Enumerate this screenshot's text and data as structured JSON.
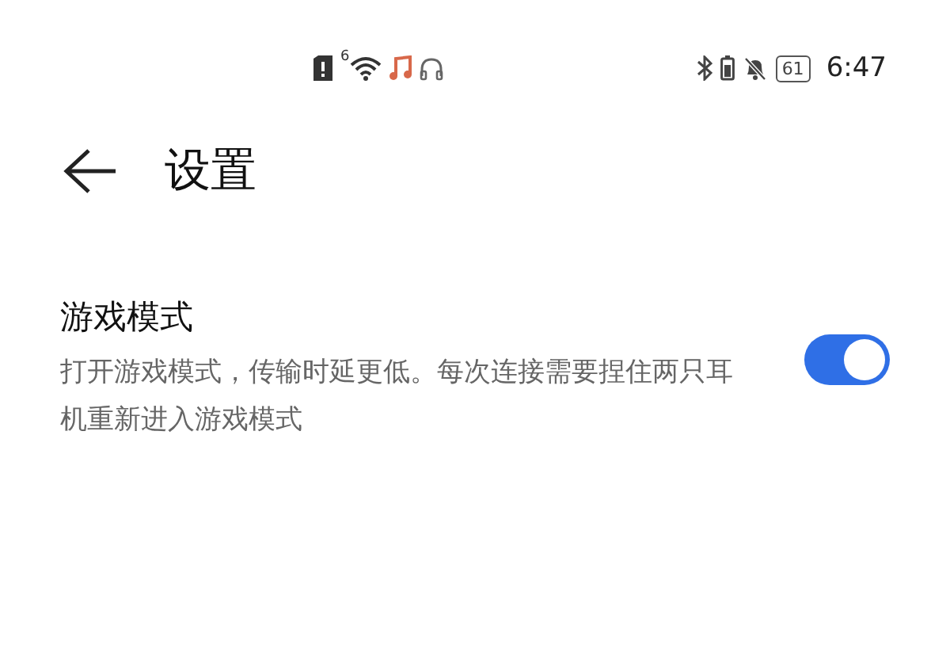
{
  "status_bar": {
    "wifi_generation": "6",
    "battery_level": "61",
    "time": "6:47"
  },
  "header": {
    "title": "设置"
  },
  "settings": [
    {
      "kind": "toggle",
      "title": "游戏模式",
      "description": "打开游戏模式，传输时延更低。每次连接需要捏住两只耳机重新进入游戏模式",
      "on": true
    }
  ]
}
